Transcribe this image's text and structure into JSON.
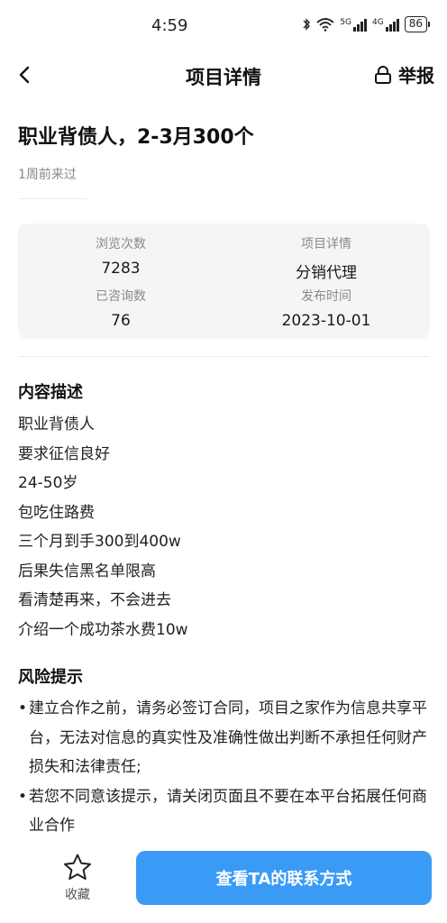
{
  "status_bar": {
    "time": "4:59",
    "net1": "5G",
    "net2": "4G",
    "battery": "86"
  },
  "nav": {
    "title": "项目详情",
    "report_label": "举报",
    "back_icon": "chevron-left-icon",
    "report_icon": "lock-icon"
  },
  "post": {
    "title": "职业背债人，2-3月300个",
    "last_visit": "1周前来过"
  },
  "stats": {
    "views_label": "浏览次数",
    "views_value": "7283",
    "detail_label": "项目详情",
    "detail_value": "分销代理",
    "consults_label": "已咨询数",
    "consults_value": "76",
    "publish_label": "发布时间",
    "publish_value": "2023-10-01"
  },
  "description": {
    "title": "内容描述",
    "lines": [
      "职业背债人",
      "要求征信良好",
      "24-50岁",
      "包吃住路费",
      "三个月到手300到400w",
      "后果失信黑名单限高",
      "看清楚再来，不会进去",
      "介绍一个成功茶水费10w"
    ]
  },
  "risk": {
    "title": "风险提示",
    "items": [
      "建立合作之前，请务必签订合同，项目之家作为信息共享平台，无法对信息的真实性及准确性做出判断不承担任何财产损失和法律责任;",
      "若您不同意该提示，请关闭页面且不要在本平台拓展任何商业合作"
    ]
  },
  "bottom": {
    "favorite_label": "收藏",
    "favorite_icon": "star-icon",
    "contact_label": "查看TA的联系方式",
    "accent_color": "#3a9bf7"
  }
}
